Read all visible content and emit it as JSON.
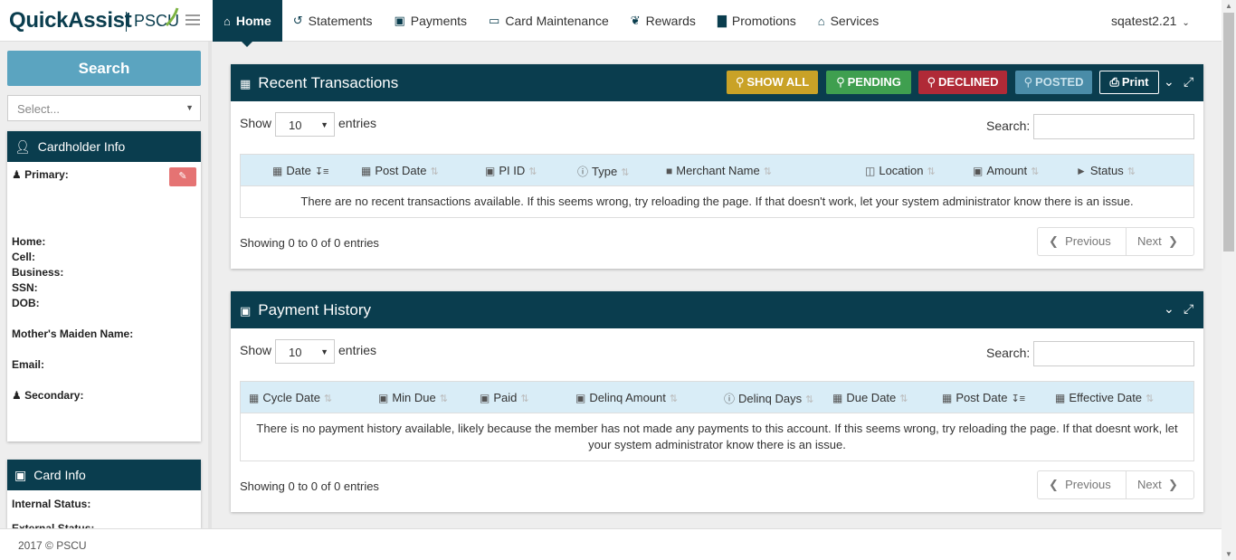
{
  "brand": {
    "name": "QuickAssist",
    "partner": "PSCU"
  },
  "nav": [
    {
      "label": "Home",
      "icon": "home-icon",
      "glyph": "⌂"
    },
    {
      "label": "Statements",
      "icon": "history-icon",
      "glyph": "↺"
    },
    {
      "label": "Payments",
      "icon": "money-icon",
      "glyph": "▣"
    },
    {
      "label": "Card Maintenance",
      "icon": "credit-card-icon",
      "glyph": "▭"
    },
    {
      "label": "Rewards",
      "icon": "gift-icon",
      "glyph": "❦"
    },
    {
      "label": "Promotions",
      "icon": "bar-chart-icon",
      "glyph": "▇"
    },
    {
      "label": "Services",
      "icon": "bank-icon",
      "glyph": "⌂"
    }
  ],
  "user": {
    "name": "sqatest2.21"
  },
  "sidebar": {
    "search_label": "Search",
    "select_placeholder": "Select...",
    "cardholder": {
      "title": "Cardholder Info",
      "primary": "Primary:",
      "home": "Home:",
      "cell": "Cell:",
      "business": "Business:",
      "ssn": "SSN:",
      "dob": "DOB:",
      "maiden": "Mother's Maiden Name:",
      "email": "Email:",
      "secondary": "Secondary:"
    },
    "cardinfo": {
      "title": "Card Info",
      "internal": "Internal Status:",
      "external": "External Status:"
    }
  },
  "transactions": {
    "title": "Recent Transactions",
    "buttons": {
      "show_all": "SHOW ALL",
      "pending": "PENDING",
      "declined": "DECLINED",
      "posted": "POSTED",
      "print": "Print"
    },
    "show": "Show",
    "length": "10",
    "entries": "entries",
    "search_label": "Search:",
    "columns": [
      "Date",
      "Post Date",
      "PI ID",
      "Type",
      "Merchant Name",
      "Location",
      "Amount",
      "Status"
    ],
    "empty": "There are no recent transactions available. If this seems wrong, try reloading the page. If that doesn't work, let your system administrator know there is an issue.",
    "info": "Showing 0 to 0 of 0 entries",
    "prev": "Previous",
    "next": "Next"
  },
  "payments": {
    "title": "Payment History",
    "show": "Show",
    "length": "10",
    "entries": "entries",
    "search_label": "Search:",
    "columns": [
      "Cycle Date",
      "Min Due",
      "Paid",
      "Delinq Amount",
      "Delinq Days",
      "Due Date",
      "Post Date",
      "Effective Date"
    ],
    "empty": "There is no payment history available, likely because the member has not made any payments to this account. If this seems wrong, try reloading the page. If that doesnt work, let your system administrator know there is an issue.",
    "info": "Showing 0 to 0 of 0 entries",
    "prev": "Previous",
    "next": "Next"
  },
  "footer": {
    "copyright": "2017 © PSCU"
  },
  "colors": {
    "navy": "#0a3d4e",
    "search": "#5ba4c0",
    "show_all": "#c9a227",
    "pending": "#3f9f4f",
    "declined": "#b02a37",
    "posted": "#4a8ca8",
    "edit": "#e57373",
    "table_head": "#d9edf7"
  }
}
